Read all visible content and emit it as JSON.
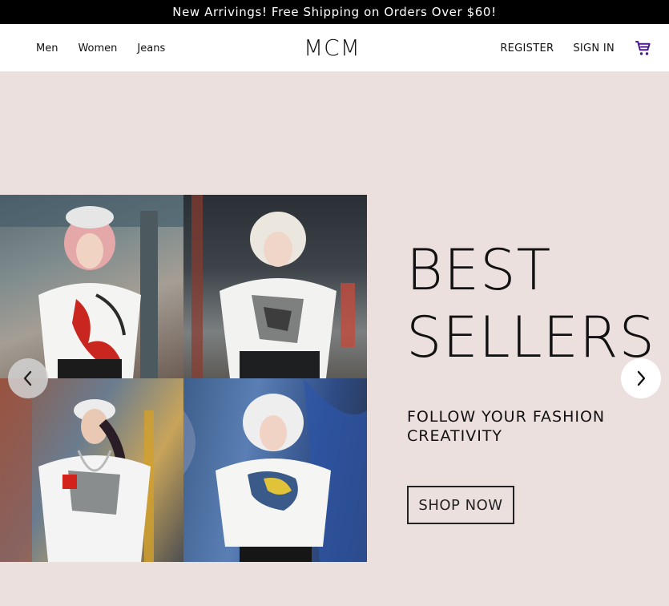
{
  "announcement": {
    "text": "New Arrivings! Free Shipping on Orders Over $60!"
  },
  "nav": {
    "left_links": [
      "Men",
      "Women",
      "Jeans"
    ],
    "logo": "MCM",
    "register": "REGISTER",
    "sign_in": "SIGN IN",
    "cart_icon": "shopping-cart-icon"
  },
  "hero": {
    "headline_line1": "BEST",
    "headline_line2": "SELLERS",
    "subline_line1": "FOLLOW YOUR FASHION",
    "subline_line2": "CREATIVITY",
    "cta": "SHOP NOW",
    "prev_icon": "chevron-left-icon",
    "next_icon": "chevron-right-icon"
  },
  "colors": {
    "hero_bg": "#ece0df",
    "announce_bg": "#000000",
    "cart_accent": "#4b1a8a"
  }
}
